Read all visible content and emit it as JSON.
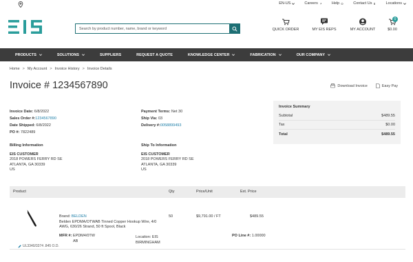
{
  "utility": {
    "language": "EN-US",
    "links": [
      "Careers",
      "Help",
      "Contact Us",
      "Locations"
    ]
  },
  "header": {
    "logo_text": "EIS",
    "search_placeholder": "Search by product number, name, brand or keyword",
    "quick_order": "QUICK ORDER",
    "reps": "MY EIS REPS",
    "account": "MY ACCOUNT",
    "cart_total": "$0.00",
    "cart_count": "0"
  },
  "nav": [
    "PRODUCTS",
    "SOLUTIONS",
    "SUPPLIERS",
    "REQUEST A QUOTE",
    "KNOWLEDGE CENTER",
    "FABRICATION",
    "OUR COMPANY"
  ],
  "breadcrumb": [
    "Home",
    "My Account",
    "Invoice History",
    "Invoice Details"
  ],
  "title": "Invoice # 1234567890",
  "actions": {
    "download": "Download Invoice",
    "easy_pay": "Easy Pay"
  },
  "meta": {
    "invoice_date_label": "Invoice Date:",
    "invoice_date": "6/8/2022",
    "sales_order_label": "Sales Order #:",
    "sales_order": "1234567890",
    "date_shipped_label": "Date Shipped:",
    "date_shipped": "6/8/2022",
    "po_label": "PO #:",
    "po": "7822489",
    "terms_label": "Payment Terms:",
    "terms": "Net 30",
    "ship_via_label": "Ship Via:",
    "ship_via": "03",
    "delivery_label": "Delivery #:",
    "delivery": "0058899493"
  },
  "billing": {
    "heading": "Billing Information",
    "name": "EIS CUSTOMER",
    "street": "2018 POWERS FERRY RD SE",
    "city": "ATLANTA, GA 30339",
    "country": "US"
  },
  "shipping": {
    "heading": "Ship To Information",
    "name": "EIS CUSTOMER",
    "street": "2018 POWERS FERRY RD SE",
    "city": "ATLANTA, GA 30339",
    "country": "US"
  },
  "summary": {
    "heading": "Invoice Summary",
    "subtotal_label": "Subtotal",
    "subtotal": "$489.55",
    "tax_label": "Tax",
    "tax": "$0.00",
    "total_label": "Total",
    "total": "$489.55"
  },
  "table": {
    "headers": {
      "product": "Product",
      "qty": "Qty",
      "price": "Price/Unit",
      "ext": "Ext. Price"
    },
    "item": {
      "brand_label": "Brand:",
      "brand": "BELDEN",
      "description": "Belden EPDMA/OTWAB Tinned Copper Hookup Wire, 4/0 AWG, 630/26 Strand, 50 ft Spool, Black",
      "mfr_label": "MFR #:",
      "mfr": "EPDM4/0TW",
      "mfr2": "AB",
      "location_label": "Location:",
      "location": "EIS",
      "location2": "BIRMINGHAM",
      "qty": "50",
      "price": "$9,791.00 / FT",
      "ext": "$489.55",
      "po_line_label": "PO Line #:",
      "po_line": "1.00000",
      "ul": "UL3340/3374 .845 O.D."
    }
  }
}
